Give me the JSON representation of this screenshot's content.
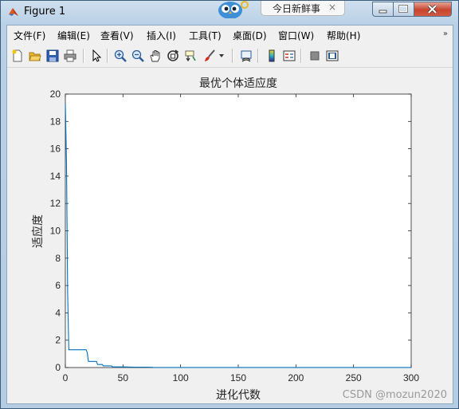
{
  "window": {
    "title": "Figure 1",
    "notification_tab": "今日新鲜事",
    "notification_close": "×"
  },
  "menu": [
    {
      "label": "文件(F)",
      "name": "menu-file"
    },
    {
      "label": "编辑(E)",
      "name": "menu-edit"
    },
    {
      "label": "查看(V)",
      "name": "menu-view"
    },
    {
      "label": "插入(I)",
      "name": "menu-insert"
    },
    {
      "label": "工具(T)",
      "name": "menu-tools"
    },
    {
      "label": "桌面(D)",
      "name": "menu-desktop"
    },
    {
      "label": "窗口(W)",
      "name": "menu-window"
    },
    {
      "label": "帮助(H)",
      "name": "menu-help"
    }
  ],
  "menu_chevron": "»",
  "toolbar_icons": [
    "new-figure-icon",
    "open-file-icon",
    "save-icon",
    "print-icon",
    "pointer-icon",
    "zoom-in-icon",
    "zoom-out-icon",
    "pan-icon",
    "rotate-3d-icon",
    "data-cursor-icon",
    "brush-icon",
    "brush-dropdown-icon",
    "link-plot-icon",
    "insert-colorbar-icon",
    "insert-legend-icon",
    "hide-plot-tools-icon",
    "show-plot-tools-icon"
  ],
  "colors": {
    "line": "#0072bd",
    "axes_bg": "#ffffff",
    "figure_bg": "#f0f0f0"
  },
  "chart_data": {
    "type": "line",
    "title": "最优个体适应度",
    "xlabel": "进化代数",
    "ylabel": "适应度",
    "xlim": [
      0,
      300
    ],
    "ylim": [
      0,
      20
    ],
    "xticks": [
      0,
      50,
      100,
      150,
      200,
      250,
      300
    ],
    "yticks": [
      0,
      2,
      4,
      6,
      8,
      10,
      12,
      14,
      16,
      18,
      20
    ],
    "grid": false,
    "series": [
      {
        "x": [
          0,
          1,
          2,
          3,
          4,
          5,
          6,
          7,
          8,
          9,
          10,
          11,
          12,
          13,
          14,
          15,
          16,
          17,
          18,
          19,
          20,
          21,
          22,
          23,
          24,
          25,
          26,
          27,
          28,
          29,
          30,
          31,
          32,
          33,
          34,
          35,
          36,
          37,
          38,
          39,
          40,
          41,
          50,
          60,
          70,
          75,
          76,
          100,
          150,
          200,
          250,
          300
        ],
        "y": [
          19.3,
          15.0,
          5.5,
          1.3,
          1.3,
          1.3,
          1.3,
          1.3,
          1.3,
          1.3,
          1.3,
          1.3,
          1.3,
          1.3,
          1.3,
          1.3,
          1.3,
          1.3,
          1.3,
          1.1,
          0.45,
          0.45,
          0.45,
          0.45,
          0.45,
          0.45,
          0.45,
          0.45,
          0.22,
          0.22,
          0.22,
          0.22,
          0.22,
          0.12,
          0.12,
          0.12,
          0.12,
          0.12,
          0.12,
          0.12,
          0.12,
          0.05,
          0.05,
          0.03,
          0.03,
          0.02,
          0.01,
          0.005,
          0.003,
          0.002,
          0.001,
          0.001
        ]
      }
    ]
  },
  "watermark": "CSDN @mozun2020"
}
